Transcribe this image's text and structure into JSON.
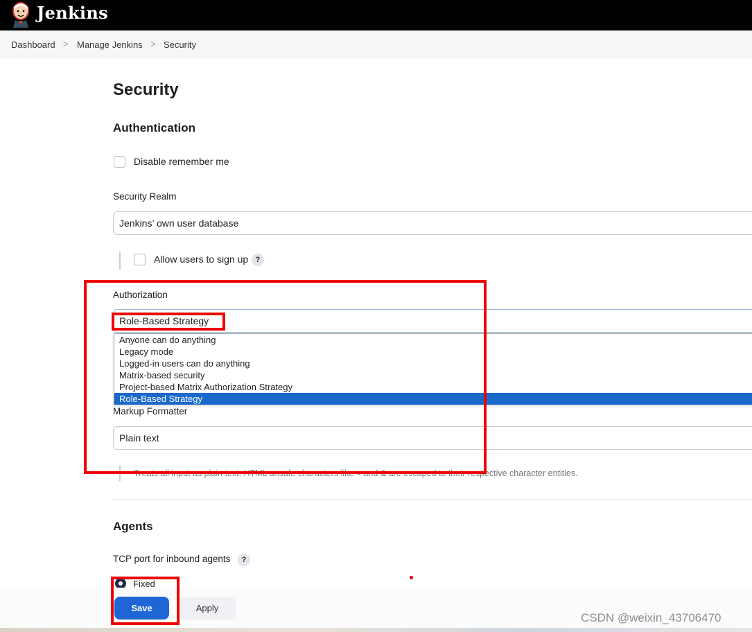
{
  "header": {
    "brand": "Jenkins",
    "logo_icon": "jenkins-butler-icon"
  },
  "breadcrumb": {
    "items": [
      "Dashboard",
      "Manage Jenkins",
      "Security"
    ],
    "separator": ">"
  },
  "page": {
    "title": "Security"
  },
  "authentication": {
    "heading": "Authentication",
    "disable_remember_me": "Disable remember me",
    "security_realm_label": "Security Realm",
    "security_realm_value": "Jenkins’ own user database",
    "allow_signup": "Allow users to sign up"
  },
  "authorization": {
    "label": "Authorization",
    "selected": "Role-Based Strategy",
    "options": [
      "Anyone can do anything",
      "Legacy mode",
      "Logged-in users can do anything",
      "Matrix-based security",
      "Project-based Matrix Authorization Strategy",
      "Role-Based Strategy"
    ],
    "selected_index": 5
  },
  "markup": {
    "label": "Markup Formatter",
    "value": "Plain text",
    "hint": "Treats all input as plain text. HTML unsafe characters like < and & are escaped to their respective character entities."
  },
  "agents": {
    "heading": "Agents",
    "tcp_label": "TCP port for inbound agents",
    "fixed_option": "Fixed"
  },
  "help_glyph": "?",
  "actions": {
    "save": "Save",
    "apply": "Apply"
  },
  "watermark": "CSDN @weixin_43706470",
  "colors": {
    "topbar": "#000000",
    "primary": "#1f65d6",
    "selected_option": "#1b6acb",
    "annotation_red": "#ee0000"
  }
}
